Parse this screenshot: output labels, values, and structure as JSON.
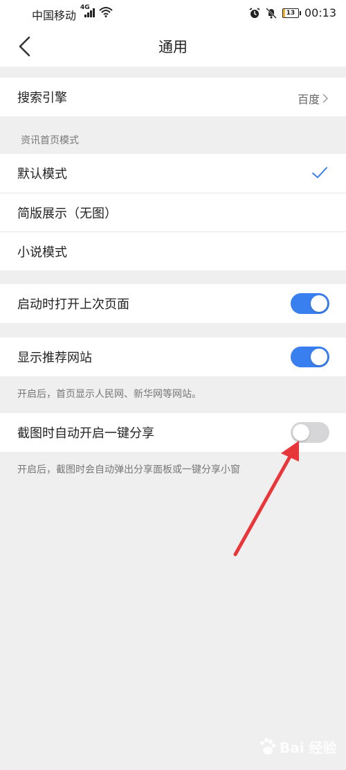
{
  "status_bar": {
    "carrier": "中国移动",
    "network": "4G",
    "battery": "13",
    "battery_level_percent": 13,
    "time": "00:13",
    "icons": [
      "signal-icon",
      "wifi-icon",
      "alarm-icon",
      "mute-icon",
      "battery-icon"
    ]
  },
  "header": {
    "title": "通用",
    "back_icon": "chevron-left-icon"
  },
  "search_engine": {
    "label": "搜索引擎",
    "value": "百度"
  },
  "news_mode": {
    "section_label": "资讯首页模式",
    "options": [
      {
        "label": "默认模式",
        "selected": true
      },
      {
        "label": "简版展示（无图）",
        "selected": false
      },
      {
        "label": "小说模式",
        "selected": false
      }
    ]
  },
  "settings": {
    "open_last_page": {
      "label": "启动时打开上次页面",
      "enabled": true
    },
    "show_sites": {
      "label": "显示推荐网站",
      "enabled": true,
      "caption": "开启后，首页显示人民网、新华网等网站。"
    },
    "screenshot_share": {
      "label": "截图时自动开启一键分享",
      "enabled": false,
      "caption": "开启后，截图时会自动弹出分享面板或一键分享小窗"
    }
  },
  "colors": {
    "accent": "#3a7ff0",
    "toggle_off": "#d6d6d8",
    "annotation_arrow": "#e8373a",
    "background": "#efeff0"
  },
  "watermark": {
    "text": "Bai 经验"
  }
}
